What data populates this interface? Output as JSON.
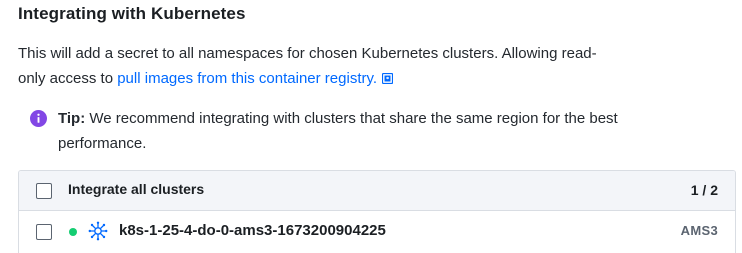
{
  "section": {
    "title": "Integrating with Kubernetes"
  },
  "description": {
    "text_before": "This will add a secret to all namespaces for chosen Kubernetes clusters. Allowing read-only access to ",
    "link_text": "pull images from this container registry.",
    "link_icon": "external-link-icon"
  },
  "tip": {
    "icon": "info-icon",
    "label": "Tip:",
    "text": " We recommend integrating with clusters that share the same region for the best performance."
  },
  "cluster_table": {
    "header": {
      "select_all_label": "Integrate all clusters",
      "count": "1 / 2"
    },
    "rows": [
      {
        "status": "active",
        "status_color": "#15cd72",
        "icon": "kubernetes-icon",
        "name": "k8s-1-25-4-do-0-ams3-1673200904225",
        "region": "AMS3"
      }
    ]
  },
  "colors": {
    "link": "#0069ff",
    "tip_icon": "#8247e5",
    "header_bg": "#f3f5f9",
    "status_active": "#15cd72",
    "kubernetes_icon": "#0069ff"
  }
}
